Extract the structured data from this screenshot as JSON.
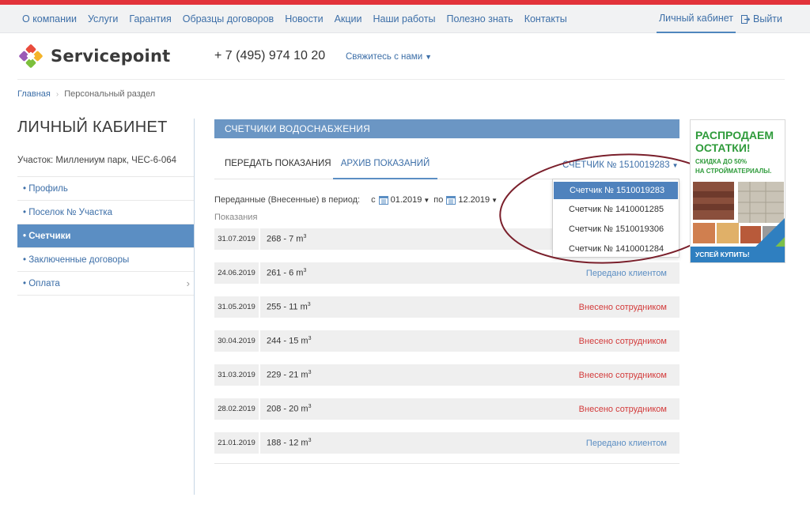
{
  "nav": {
    "items": [
      "О компании",
      "Услуги",
      "Гарантия",
      "Образцы договоров",
      "Новости",
      "Акции",
      "Наши работы",
      "Полезно знать",
      "Контакты"
    ],
    "cabinet": "Личный кабинет",
    "logout": "Выйти"
  },
  "header": {
    "brand": "Servicepoint",
    "phone": "+ 7 (495) 974 10 20",
    "contact": "Свяжитесь с нами"
  },
  "breadcrumb": {
    "home": "Главная",
    "current": "Персональный раздел"
  },
  "sidebar": {
    "title": "ЛИЧНЫЙ КАБИНЕТ",
    "plot": "Участок: Миллениум парк, ЧЕС-6-064",
    "items": [
      {
        "label": "• Профиль"
      },
      {
        "label": "• Поселок № Участка"
      },
      {
        "label": "• Счетчики"
      },
      {
        "label": "• Заключенные договоры"
      },
      {
        "label": "• Оплата"
      }
    ]
  },
  "main": {
    "panel_title": "СЧЕТЧИКИ ВОДОСНАБЖЕНИЯ",
    "tabs": [
      "ПЕРЕДАТЬ ПОКАЗАНИЯ",
      "АРХИВ ПОКАЗАНИЙ"
    ],
    "meter_select": "СЧЕТЧИК № 1510019283",
    "period_label": "Переданные (Внесенные) в период:",
    "from_label": "с",
    "from_value": "01.2019",
    "to_label": "по",
    "to_value": "12.2019",
    "readings_label": "Показания",
    "rows": [
      {
        "date": "31.07.2019",
        "value": "268 - 7 m",
        "status": ""
      },
      {
        "date": "24.06.2019",
        "value": "261 - 6 m",
        "status": "Передано клиентом"
      },
      {
        "date": "31.05.2019",
        "value": "255 - 11 m",
        "status": "Внесено сотрудником"
      },
      {
        "date": "30.04.2019",
        "value": "244 - 15 m",
        "status": "Внесено сотрудником"
      },
      {
        "date": "31.03.2019",
        "value": "229 - 21 m",
        "status": "Внесено сотрудником"
      },
      {
        "date": "28.02.2019",
        "value": "208 - 20 m",
        "status": "Внесено сотрудником"
      },
      {
        "date": "21.01.2019",
        "value": "188 - 12 m",
        "status": "Передано клиентом"
      }
    ],
    "unit_exp": "3"
  },
  "dropdown": {
    "options": [
      "Счетчик № 1510019283",
      "Счетчик № 1410001285",
      "Счетчик № 1510019306",
      "Счетчик № 1410001284"
    ]
  },
  "ad": {
    "title_line1": "РАСПРОДАЕМ",
    "title_line2": "ОСТАТКИ!",
    "sub_line1": "СКИДКА ДО 50%",
    "sub_line2": "НА СТРОЙМАТЕРИАЛЫ.",
    "cta": "УСПЕЙ КУПИТЬ!"
  },
  "colors": {
    "accent": "#5b8ec3",
    "brand_red": "#e2333a",
    "status_client": "#5b8ec3",
    "status_staff": "#d33a3a",
    "annotation": "#7a1f2b"
  }
}
